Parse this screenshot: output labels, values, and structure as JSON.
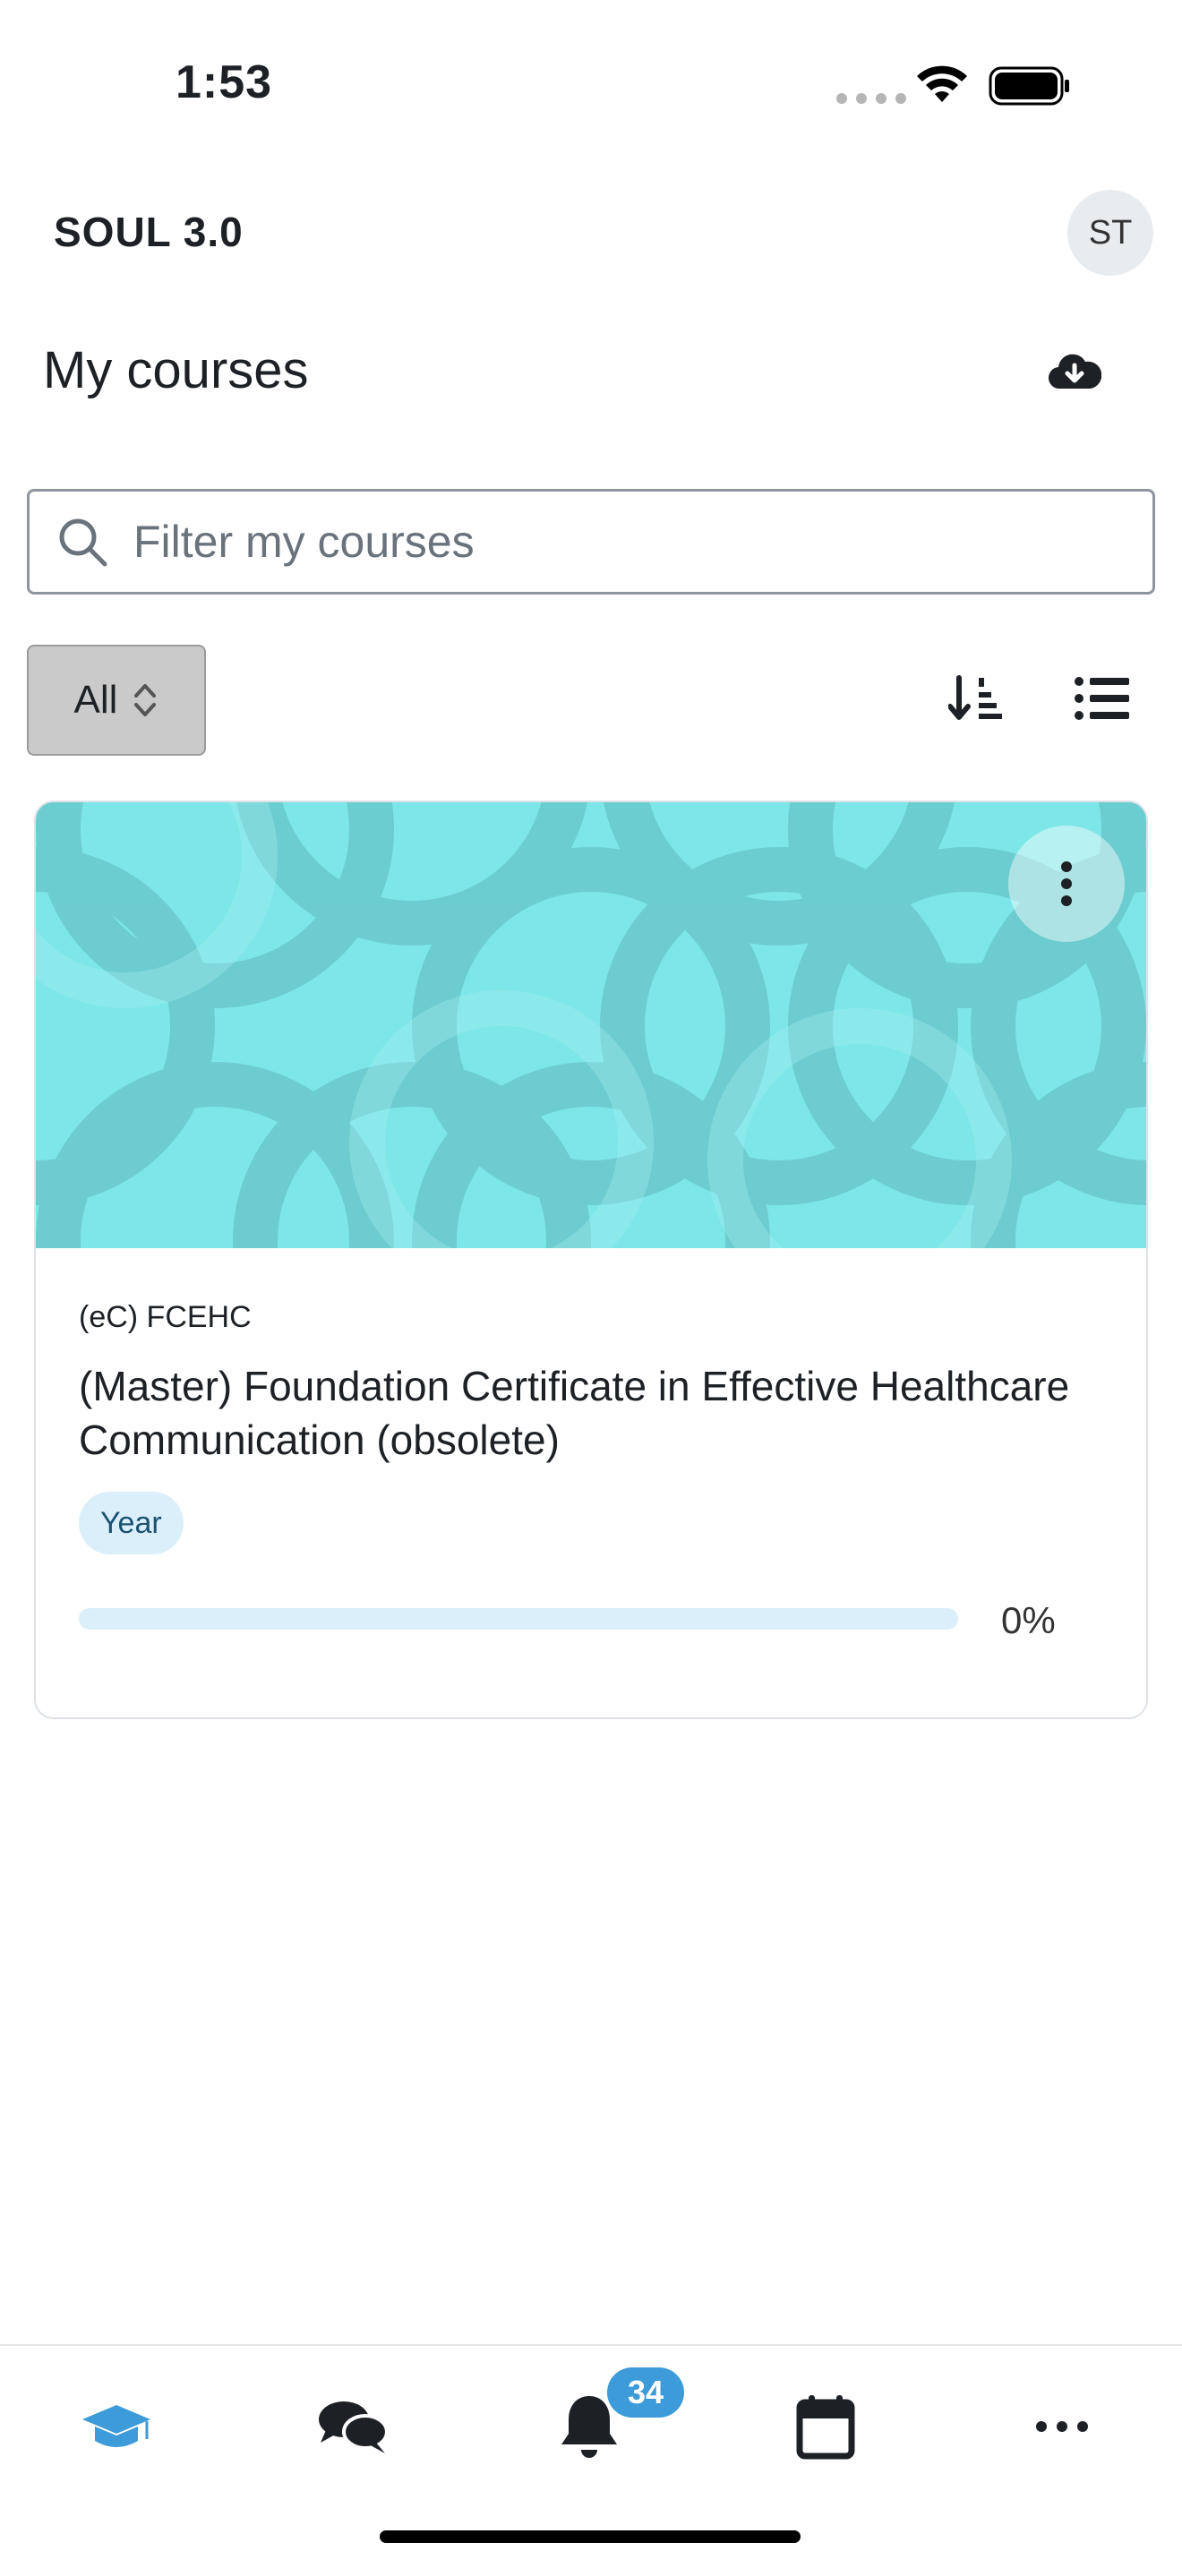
{
  "status_bar": {
    "time": "1:53"
  },
  "header": {
    "site_name": "SOUL 3.0",
    "avatar_initials": "ST"
  },
  "page": {
    "title": "My courses",
    "download_icon": "cloud-download-icon"
  },
  "search": {
    "placeholder": "Filter my courses",
    "value": ""
  },
  "filter": {
    "selected": "All"
  },
  "course": {
    "short_name": "(eC) FCEHC",
    "full_name": "(Master) Foundation Certificate in Effective Healthcare Communication (obsolete)",
    "badge": "Year",
    "progress": 0,
    "progress_label": "0%",
    "image_color": "#7de6e8"
  },
  "tabbar": {
    "items": [
      "my-courses",
      "messages",
      "notifications",
      "calendar",
      "more"
    ],
    "notification_count": "34",
    "active_color": "#3d9bd9"
  }
}
